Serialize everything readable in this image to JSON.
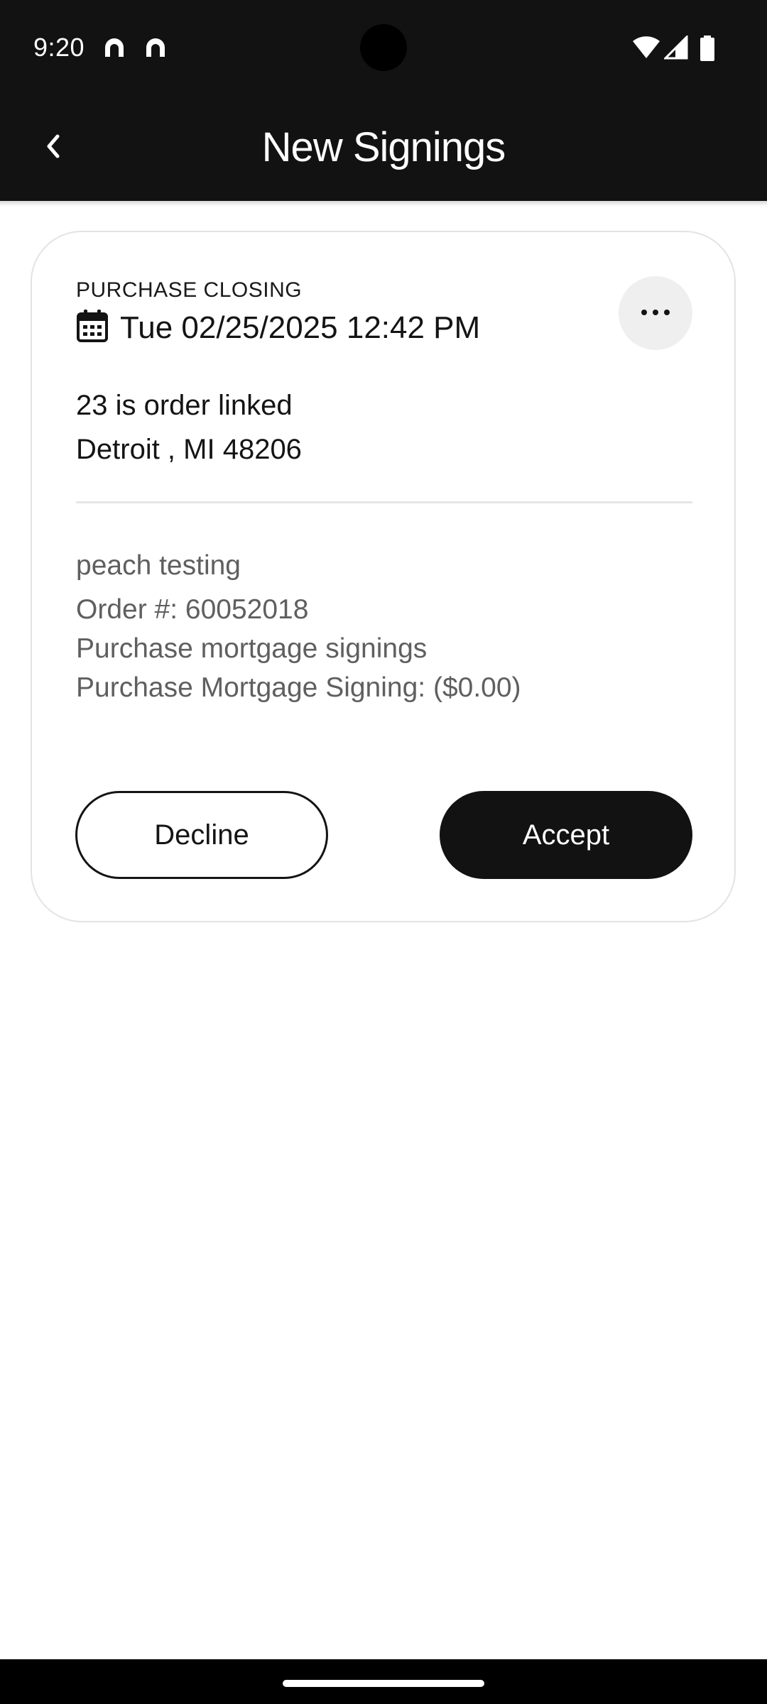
{
  "status_bar": {
    "time": "9:20"
  },
  "header": {
    "title": "New Signings",
    "back_icon": "chevron-left-icon"
  },
  "card": {
    "type_label": "PURCHASE CLOSING",
    "date": "Tue 02/25/2025 12:42 PM",
    "address_line1": "23 is order linked",
    "address_line2": "Detroit , MI 48206",
    "detail_title": "peach testing",
    "order_number": "Order #: 60052018",
    "product": "Purchase mortgage signings",
    "fee": "Purchase Mortgage Signing: ($0.00)",
    "decline_label": "Decline",
    "accept_label": "Accept"
  },
  "colors": {
    "header_bg": "#121212",
    "primary_button": "#121212",
    "more_button_bg": "#efefef",
    "secondary_text": "#5f5f5f"
  }
}
